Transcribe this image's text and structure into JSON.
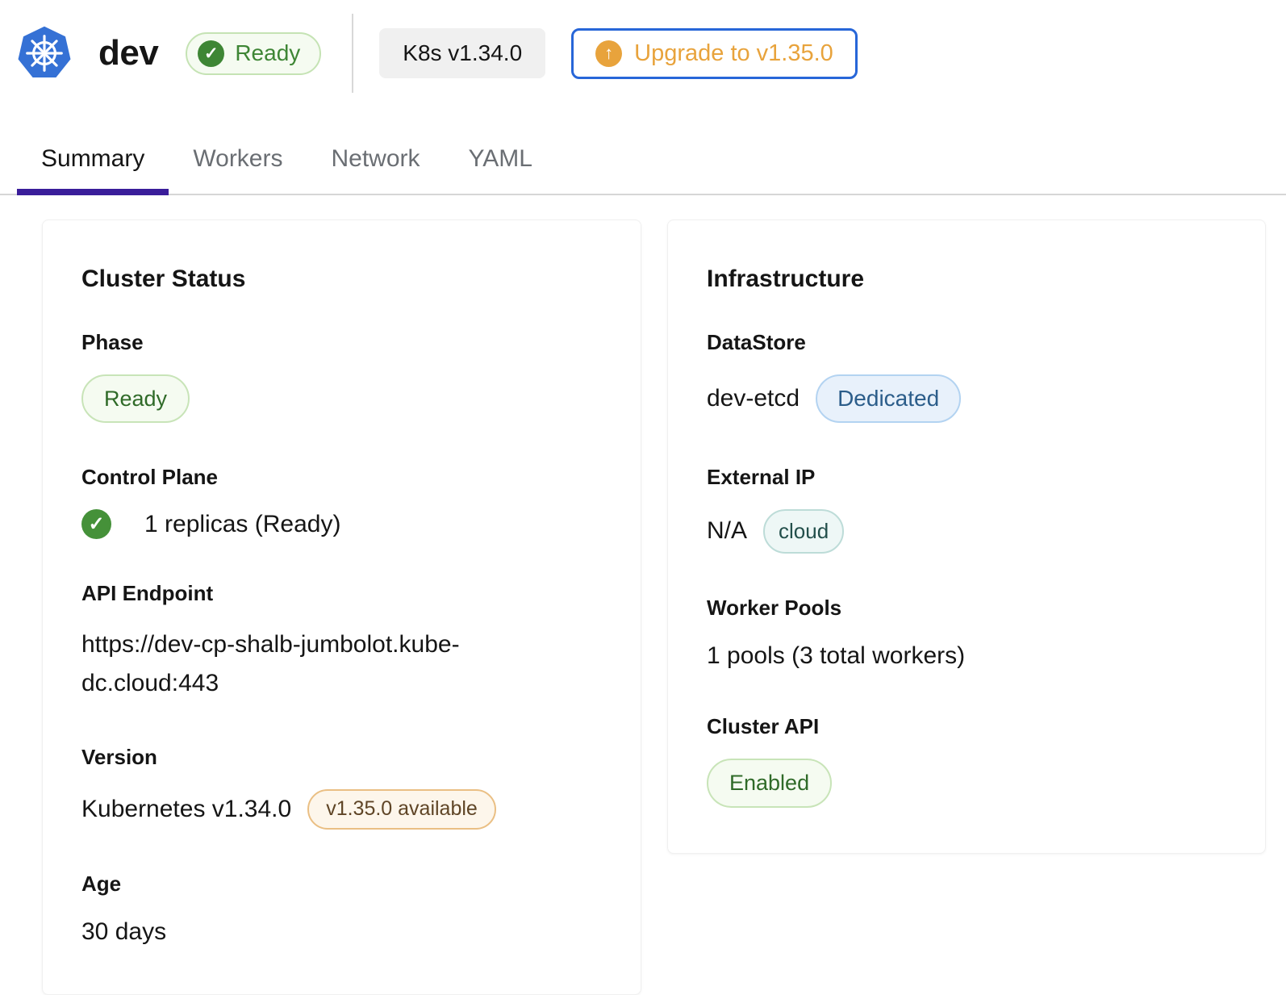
{
  "header": {
    "cluster_name": "dev",
    "status_badge": "Ready",
    "status_check_glyph": "✓",
    "k8s_version_badge": "K8s v1.34.0",
    "upgrade_button_label": "Upgrade to v1.35.0",
    "upgrade_arrow_glyph": "↑"
  },
  "tabs": [
    {
      "label": "Summary",
      "active": true
    },
    {
      "label": "Workers",
      "active": false
    },
    {
      "label": "Network",
      "active": false
    },
    {
      "label": "YAML",
      "active": false
    }
  ],
  "cluster_status_card": {
    "title": "Cluster Status",
    "phase": {
      "label": "Phase",
      "value": "Ready"
    },
    "control_plane": {
      "label": "Control Plane",
      "value": "1 replicas (Ready)",
      "check_glyph": "✓"
    },
    "api_endpoint": {
      "label": "API Endpoint",
      "value": "https://dev-cp-shalb-jumbolot.kube-dc.cloud:443"
    },
    "version": {
      "label": "Version",
      "value": "Kubernetes v1.34.0",
      "badge": "v1.35.0 available"
    },
    "age": {
      "label": "Age",
      "value": "30 days"
    }
  },
  "infrastructure_card": {
    "title": "Infrastructure",
    "datastore": {
      "label": "DataStore",
      "value": "dev-etcd",
      "badge": "Dedicated"
    },
    "external_ip": {
      "label": "External IP",
      "value": "N/A",
      "badge": "cloud"
    },
    "worker_pools": {
      "label": "Worker Pools",
      "value": "1 pools (3 total workers)"
    },
    "cluster_api": {
      "label": "Cluster API",
      "value": "Enabled"
    }
  },
  "colors": {
    "kubernetes_blue": "#3571d5",
    "active_tab_purple": "#3a1d9a",
    "success_green": "#3e8635",
    "upgrade_border_blue": "#2766d8",
    "upgrade_amber": "#e8a33c",
    "badge_blue_text": "#2b5d8a",
    "badge_teal_text": "#234f4b",
    "badge_orange_text": "#5f4526"
  }
}
